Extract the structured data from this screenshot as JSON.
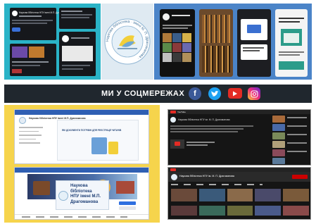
{
  "banner": {
    "title": "МИ У СОЦМЕРЕЖАХ",
    "icons": [
      "facebook-icon",
      "twitter-icon",
      "youtube-icon",
      "instagram-icon"
    ],
    "colors": {
      "facebook": "#3b5998",
      "twitter": "#1da1f2",
      "youtube": "#e32b24",
      "instagram": "#d6249f"
    }
  },
  "logo": {
    "ring_text": "Наукова бібліотека · імені М. П. Драгоманова ·"
  },
  "facebook": {
    "page_name": "Наукова бібліотека НПУ імені М.П. Драгоманова",
    "cover_lines": [
      "Наукова",
      "бібліотека",
      "НПУ імені М.П.",
      "Драгоманова"
    ],
    "post_text": "ЯКІ ДОКУМЕНТИ ПОТРІБНІ ДЛЯ РЕЄСТРАЦІЇ ЧИТАЧІВ",
    "cover_logo_title": "НАУКОВА БІБЛІОТЕКА"
  },
  "youtube": {
    "channel_name": "Наукова бібліотека НПУ ім. М. П. Драгоманова",
    "logo_label": "YouTube"
  },
  "instagram": {
    "story_labels": [
      "",
      "",
      ""
    ]
  }
}
